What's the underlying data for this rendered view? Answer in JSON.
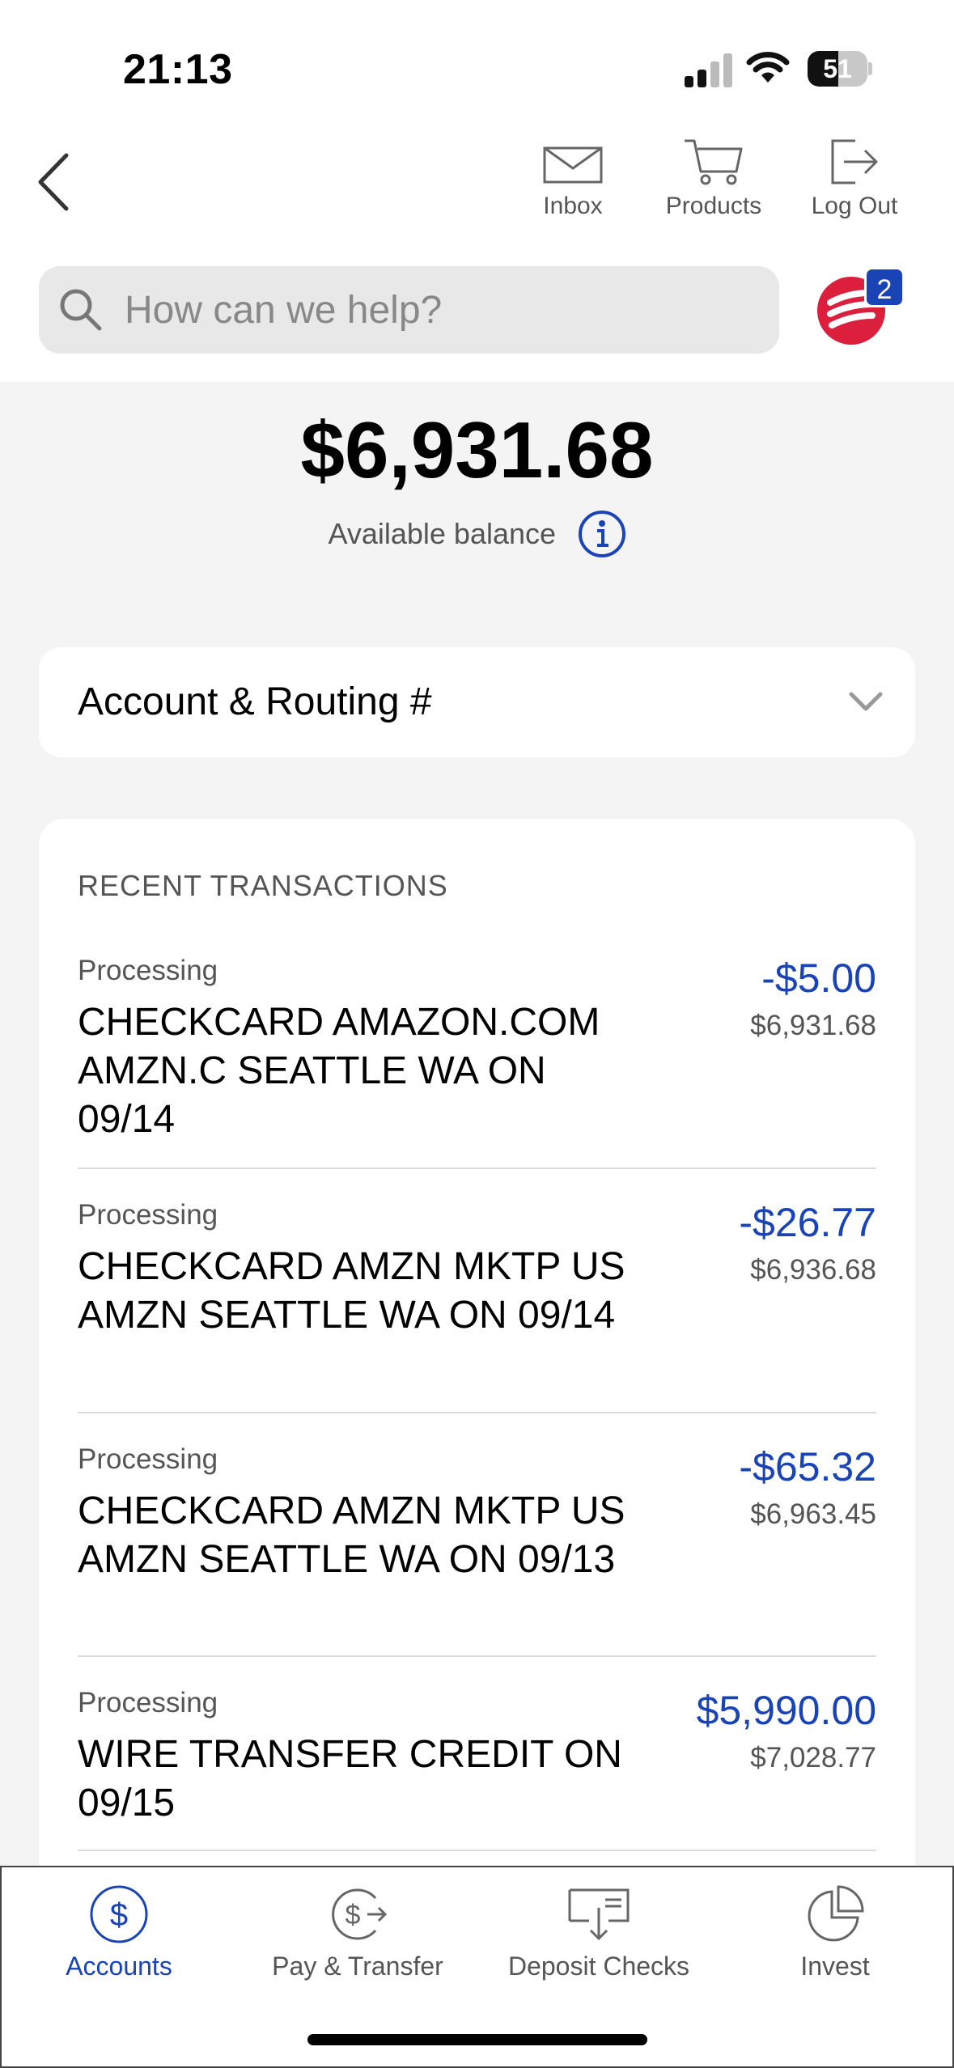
{
  "status_bar": {
    "time": "21:13",
    "battery": "51",
    "battery_level": 0.51
  },
  "nav": {
    "inbox_label": "Inbox",
    "products_label": "Products",
    "logout_label": "Log Out"
  },
  "search": {
    "placeholder": "How can we help?"
  },
  "assistant": {
    "badge_count": "2"
  },
  "balance": {
    "amount": "$6,931.68",
    "label": "Available balance"
  },
  "account_routing": {
    "title": "Account & Routing #"
  },
  "transactions": {
    "heading": "RECENT TRANSACTIONS",
    "items": [
      {
        "status": "Processing",
        "description": "CHECKCARD AMAZON.COM AMZN.C SEATTLE WA ON 09/14",
        "amount": "-$5.00",
        "running_balance": "$6,931.68"
      },
      {
        "status": "Processing",
        "description": "CHECKCARD AMZN MKTP US AMZN SEATTLE WA ON 09/14",
        "amount": "-$26.77",
        "running_balance": "$6,936.68"
      },
      {
        "status": "Processing",
        "description": "CHECKCARD AMZN MKTP US AMZN SEATTLE WA ON 09/13",
        "amount": "-$65.32",
        "running_balance": "$6,963.45"
      },
      {
        "status": "Processing",
        "description": "WIRE TRANSFER CREDIT ON 09/15",
        "amount": "$5,990.00",
        "running_balance": "$7,028.77"
      }
    ]
  },
  "tabbar": {
    "accounts_label": "Accounts",
    "pay_label": "Pay & Transfer",
    "deposit_label": "Deposit Checks",
    "invest_label": "Invest"
  },
  "colors": {
    "accent_blue": "#1a44b5",
    "brand_red": "#dc1f3c"
  }
}
